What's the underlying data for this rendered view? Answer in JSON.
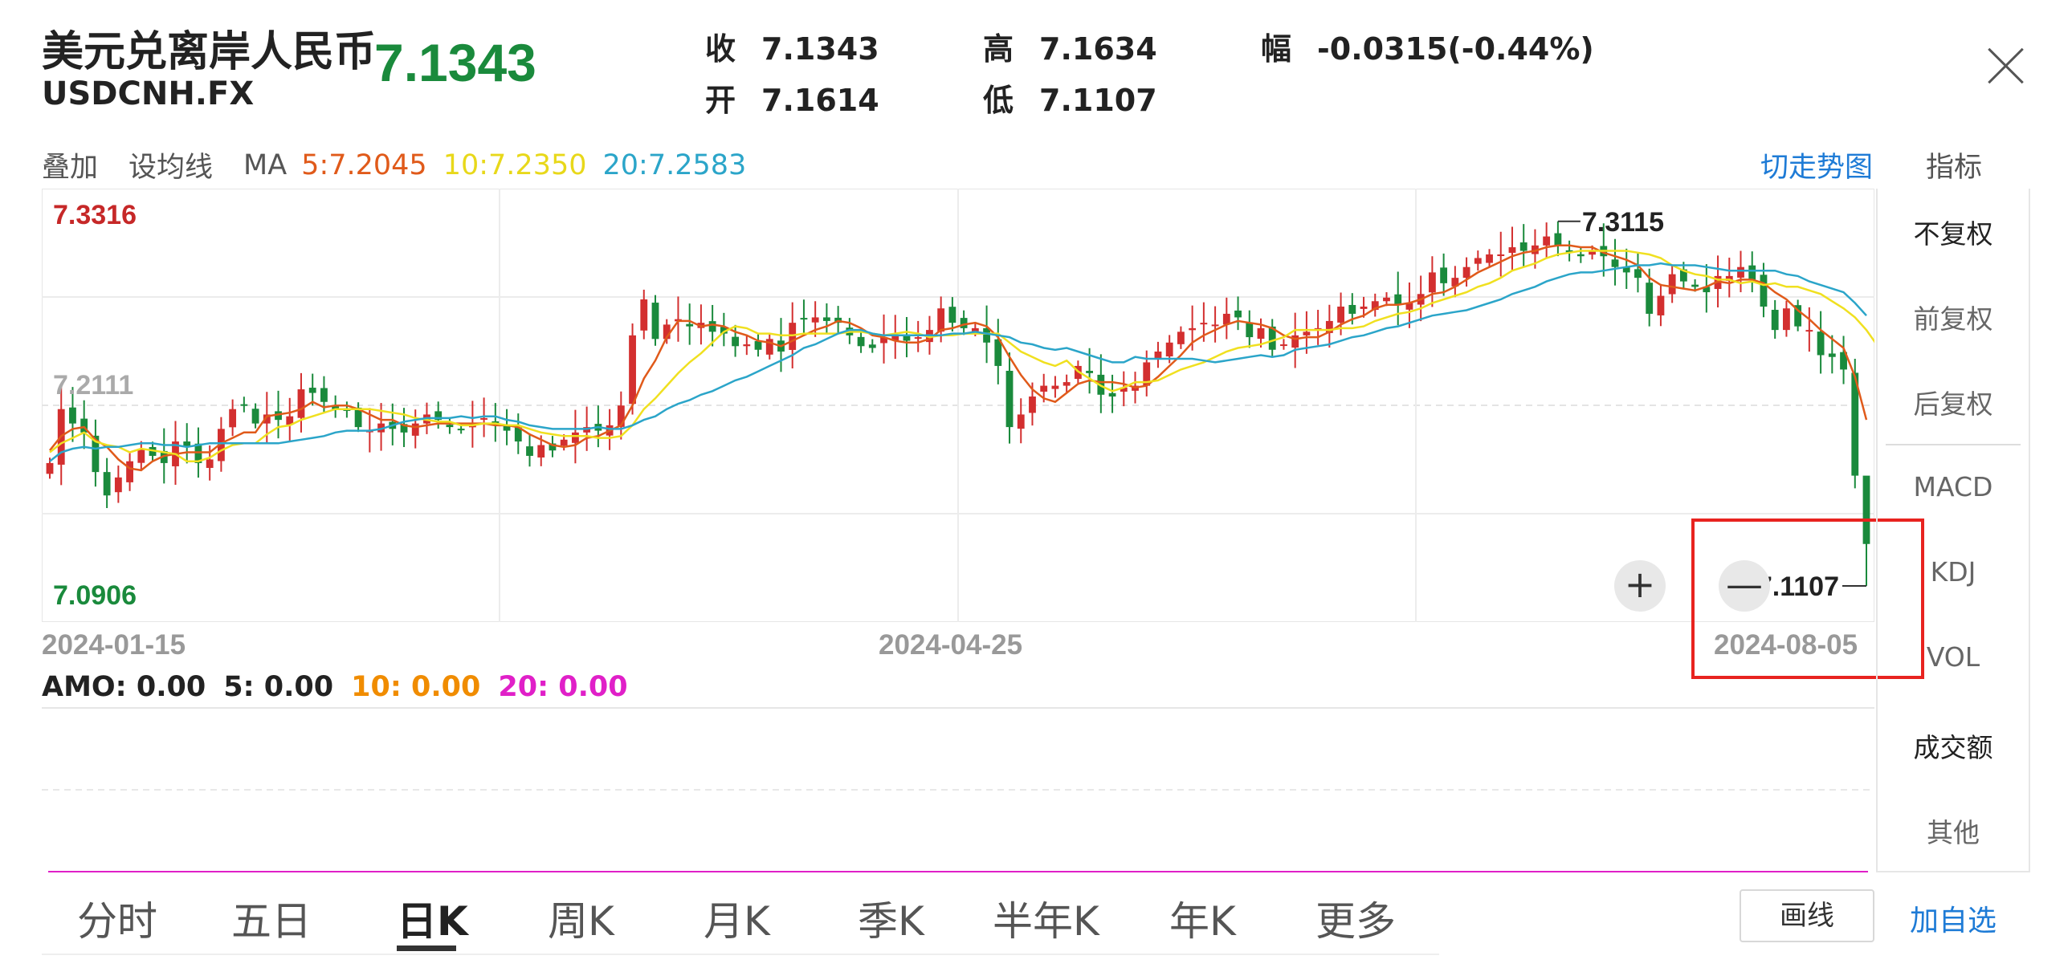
{
  "header": {
    "title": "美元兑离岸人民币",
    "symbol": "USDCNH.FX",
    "price": "7.1343",
    "price_color": "#1a8a3c",
    "stats": [
      {
        "key": "收",
        "value": "7.1343"
      },
      {
        "key": "开",
        "value": "7.1614"
      },
      {
        "key": "高",
        "value": "7.1634"
      },
      {
        "key": "低",
        "value": "7.1107"
      },
      {
        "key": "幅",
        "value": "-0.0315(-0.44%)"
      }
    ],
    "close_icon": "close-icon"
  },
  "ma_bar": {
    "overlay": "叠加",
    "set_ma": "设均线",
    "ma_label": "MA",
    "ma5": "5:7.2045",
    "ma10": "10:7.2350",
    "ma20": "20:7.2583",
    "ma5_color": "#e05a1a",
    "ma10_color": "#e8d81a",
    "ma20_color": "#2ba5c9",
    "switch_trend": "切走势图",
    "indicators": "指标"
  },
  "side_menu": [
    "不复权",
    "前复权",
    "后复权",
    "MACD",
    "KDJ",
    "VOL",
    "成交额",
    "其他"
  ],
  "chart_data": {
    "type": "candlestick",
    "ylim": [
      7.0906,
      7.3316
    ],
    "y_labels": {
      "top": "7.3316",
      "mid": "7.2111",
      "bottom": "7.0906"
    },
    "x_labels": [
      "2024-01-15",
      "2024-04-25",
      "2024-08-05"
    ],
    "high_marker": "7.3115",
    "low_marker": "7.1107",
    "up_color": "#d32f2f",
    "down_color": "#1a8a3c",
    "closes": [
      7.179,
      7.209,
      7.201,
      7.196,
      7.174,
      7.161,
      7.171,
      7.18,
      7.187,
      7.183,
      7.179,
      7.191,
      7.188,
      7.179,
      7.181,
      7.198,
      7.209,
      7.211,
      7.201,
      7.206,
      7.203,
      7.205,
      7.22,
      7.218,
      7.213,
      7.209,
      7.208,
      7.199,
      7.197,
      7.201,
      7.198,
      7.196,
      7.201,
      7.206,
      7.203,
      7.199,
      7.198,
      7.201,
      7.204,
      7.2,
      7.197,
      7.191,
      7.183,
      7.189,
      7.186,
      7.192,
      7.196,
      7.199,
      7.197,
      7.2,
      7.211,
      7.25,
      7.27,
      7.248,
      7.256,
      7.259,
      7.255,
      7.257,
      7.252,
      7.251,
      7.244,
      7.245,
      7.242,
      7.248,
      7.241,
      7.257,
      7.259,
      7.26,
      7.258,
      7.257,
      7.25,
      7.244,
      7.243,
      7.249,
      7.25,
      7.247,
      7.249,
      7.253,
      7.265,
      7.257,
      7.254,
      7.254,
      7.246,
      7.233,
      7.199,
      7.206,
      7.216,
      7.222,
      7.222,
      7.224,
      7.233,
      7.229,
      7.217,
      7.216,
      7.221,
      7.222,
      7.235,
      7.241,
      7.246,
      7.252,
      7.254,
      7.257,
      7.256,
      7.262,
      7.26,
      7.249,
      7.254,
      7.242,
      7.245,
      7.25,
      7.252,
      7.254,
      7.258,
      7.266,
      7.262,
      7.266,
      7.269,
      7.271,
      7.267,
      7.268,
      7.273,
      7.285,
      7.279,
      7.282,
      7.288,
      7.293,
      7.295,
      7.295,
      7.299,
      7.297,
      7.3,
      7.305,
      7.3,
      7.296,
      7.294,
      7.297,
      7.294,
      7.288,
      7.285,
      7.282,
      7.262,
      7.272,
      7.284,
      7.28,
      7.277,
      7.274,
      7.283,
      7.283,
      7.288,
      7.281,
      7.266,
      7.253,
      7.265,
      7.255,
      7.253,
      7.239,
      7.238,
      7.231,
      7.172,
      7.134
    ],
    "ma5": [
      7.186,
      7.194,
      7.198,
      7.199,
      7.192,
      7.188,
      7.181,
      7.176,
      7.175,
      7.18,
      7.183,
      7.184,
      7.185,
      7.185,
      7.185,
      7.19,
      7.193,
      7.196,
      7.196,
      7.205,
      7.206,
      7.207,
      7.209,
      7.213,
      7.21,
      7.211,
      7.211,
      7.209,
      7.206,
      7.203,
      7.203,
      7.2,
      7.199,
      7.2,
      7.201,
      7.201,
      7.201,
      7.201,
      7.201,
      7.2,
      7.2,
      7.199,
      7.195,
      7.192,
      7.189,
      7.188,
      7.189,
      7.193,
      7.194,
      7.197,
      7.2,
      7.211,
      7.226,
      7.236,
      7.249,
      7.258,
      7.258,
      7.255,
      7.256,
      7.255,
      7.252,
      7.25,
      7.247,
      7.246,
      7.244,
      7.247,
      7.25,
      7.253,
      7.255,
      7.258,
      7.257,
      7.254,
      7.25,
      7.249,
      7.247,
      7.246,
      7.246,
      7.248,
      7.253,
      7.254,
      7.256,
      7.257,
      7.255,
      7.249,
      7.238,
      7.228,
      7.22,
      7.215,
      7.213,
      7.218,
      7.223,
      7.225,
      7.224,
      7.224,
      7.223,
      7.221,
      7.222,
      7.227,
      7.233,
      7.239,
      7.246,
      7.25,
      7.253,
      7.256,
      7.258,
      7.257,
      7.256,
      7.254,
      7.25,
      7.248,
      7.249,
      7.249,
      7.252,
      7.256,
      7.259,
      7.261,
      7.265,
      7.267,
      7.267,
      7.268,
      7.27,
      7.273,
      7.274,
      7.277,
      7.281,
      7.285,
      7.288,
      7.291,
      7.294,
      7.296,
      7.297,
      7.299,
      7.3,
      7.3,
      7.299,
      7.299,
      7.296,
      7.294,
      7.292,
      7.289,
      7.282,
      7.278,
      7.277,
      7.276,
      7.275,
      7.277,
      7.28,
      7.279,
      7.281,
      7.281,
      7.279,
      7.274,
      7.27,
      7.264,
      7.259,
      7.253,
      7.248,
      7.243,
      7.227,
      7.203
    ],
    "ma10": [
      7.185,
      7.19,
      7.193,
      7.196,
      7.191,
      7.189,
      7.188,
      7.185,
      7.187,
      7.186,
      7.185,
      7.184,
      7.18,
      7.18,
      7.182,
      7.186,
      7.189,
      7.19,
      7.19,
      7.195,
      7.199,
      7.2,
      7.203,
      7.205,
      7.207,
      7.209,
      7.209,
      7.209,
      7.209,
      7.208,
      7.207,
      7.206,
      7.204,
      7.203,
      7.202,
      7.202,
      7.2,
      7.2,
      7.201,
      7.201,
      7.2,
      7.2,
      7.198,
      7.196,
      7.195,
      7.194,
      7.194,
      7.194,
      7.193,
      7.193,
      7.194,
      7.2,
      7.209,
      7.215,
      7.222,
      7.229,
      7.235,
      7.24,
      7.246,
      7.252,
      7.255,
      7.254,
      7.251,
      7.251,
      7.25,
      7.25,
      7.251,
      7.251,
      7.251,
      7.251,
      7.252,
      7.252,
      7.251,
      7.25,
      7.251,
      7.252,
      7.251,
      7.249,
      7.25,
      7.25,
      7.251,
      7.251,
      7.251,
      7.251,
      7.246,
      7.241,
      7.238,
      7.235,
      7.233,
      7.236,
      7.23,
      7.226,
      7.222,
      7.219,
      7.221,
      7.224,
      7.224,
      7.225,
      7.228,
      7.231,
      7.233,
      7.235,
      7.238,
      7.241,
      7.243,
      7.244,
      7.245,
      7.247,
      7.249,
      7.253,
      7.253,
      7.253,
      7.253,
      7.254,
      7.254,
      7.255,
      7.258,
      7.26,
      7.262,
      7.263,
      7.265,
      7.268,
      7.27,
      7.272,
      7.274,
      7.277,
      7.279,
      7.282,
      7.286,
      7.288,
      7.29,
      7.293,
      7.295,
      7.296,
      7.297,
      7.297,
      7.297,
      7.297,
      7.297,
      7.296,
      7.295,
      7.293,
      7.289,
      7.286,
      7.284,
      7.283,
      7.281,
      7.281,
      7.279,
      7.28,
      7.278,
      7.279,
      7.277,
      7.277,
      7.275,
      7.273,
      7.269,
      7.265,
      7.26,
      7.253,
      7.244,
      7.231
    ],
    "ma20": [
      7.18,
      7.185,
      7.187,
      7.188,
      7.187,
      7.188,
      7.188,
      7.189,
      7.19,
      7.19,
      7.189,
      7.189,
      7.188,
      7.189,
      7.19,
      7.19,
      7.19,
      7.19,
      7.19,
      7.19,
      7.19,
      7.191,
      7.192,
      7.193,
      7.194,
      7.196,
      7.197,
      7.197,
      7.197,
      7.198,
      7.2,
      7.202,
      7.203,
      7.204,
      7.204,
      7.204,
      7.205,
      7.204,
      7.205,
      7.205,
      7.203,
      7.202,
      7.2,
      7.199,
      7.198,
      7.198,
      7.198,
      7.198,
      7.199,
      7.198,
      7.198,
      7.2,
      7.203,
      7.205,
      7.209,
      7.212,
      7.214,
      7.217,
      7.219,
      7.222,
      7.225,
      7.227,
      7.23,
      7.233,
      7.236,
      7.239,
      7.243,
      7.245,
      7.248,
      7.251,
      7.253,
      7.253,
      7.251,
      7.25,
      7.25,
      7.25,
      7.25,
      7.25,
      7.25,
      7.251,
      7.251,
      7.252,
      7.251,
      7.25,
      7.249,
      7.246,
      7.245,
      7.243,
      7.242,
      7.243,
      7.241,
      7.239,
      7.237,
      7.235,
      7.235,
      7.238,
      7.237,
      7.237,
      7.237,
      7.237,
      7.237,
      7.236,
      7.235,
      7.236,
      7.237,
      7.238,
      7.239,
      7.238,
      7.239,
      7.242,
      7.243,
      7.244,
      7.245,
      7.247,
      7.249,
      7.25,
      7.252,
      7.254,
      7.255,
      7.257,
      7.259,
      7.261,
      7.262,
      7.263,
      7.264,
      7.266,
      7.268,
      7.27,
      7.273,
      7.275,
      7.277,
      7.28,
      7.282,
      7.284,
      7.285,
      7.285,
      7.286,
      7.287,
      7.288,
      7.289,
      7.289,
      7.29,
      7.289,
      7.289,
      7.289,
      7.288,
      7.287,
      7.286,
      7.286,
      7.286,
      7.286,
      7.286,
      7.284,
      7.283,
      7.28,
      7.278,
      7.276,
      7.274,
      7.268,
      7.261
    ]
  },
  "volume_bar": {
    "amo": "AMO: 0.00",
    "v5": "5: 0.00",
    "v10": "10: 0.00",
    "v20": "20: 0.00",
    "v10_color": "#f08c00",
    "v20_color": "#e020c8"
  },
  "tabs": [
    "分时",
    "五日",
    "日K",
    "周K",
    "月K",
    "季K",
    "半年K",
    "年K",
    "更多"
  ],
  "active_tab": "日K",
  "draw_button": "画线",
  "add_favorite": "加自选",
  "zoom_in": "+",
  "zoom_out": "—",
  "accent_color": "#1e7bd6"
}
